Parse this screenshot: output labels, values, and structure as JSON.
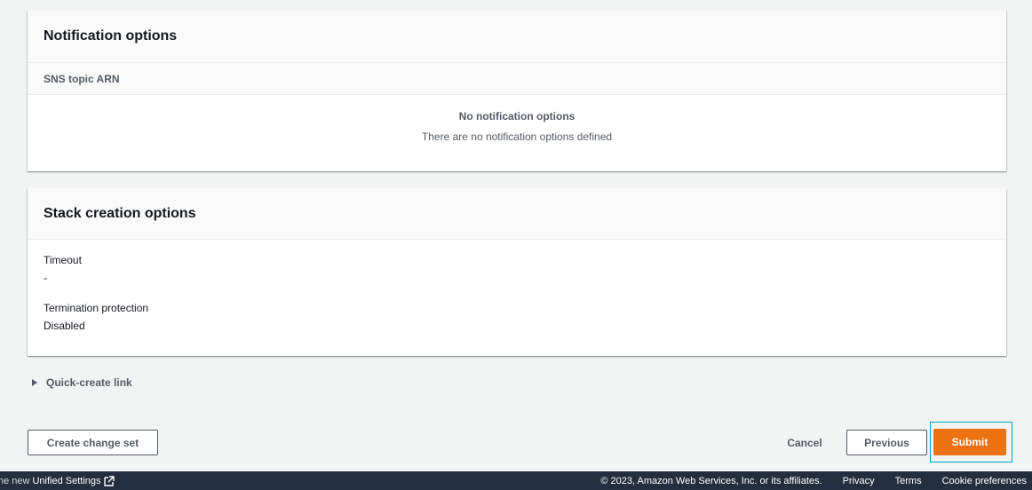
{
  "notification": {
    "title": "Notification options",
    "column": "SNS topic ARN",
    "empty_title": "No notification options",
    "empty_desc": "There are no notification options defined"
  },
  "stack": {
    "title": "Stack creation options",
    "items": [
      {
        "key": "Timeout",
        "value": "-"
      },
      {
        "key": "Termination protection",
        "value": "Disabled"
      }
    ]
  },
  "quick_create": {
    "label": "Quick-create link"
  },
  "actions": {
    "create_change_set": "Create change set",
    "cancel": "Cancel",
    "previous": "Previous",
    "submit": "Submit"
  },
  "footer": {
    "left_prefix": "he new",
    "left_link": "Unified Settings",
    "copyright": "© 2023, Amazon Web Services, Inc. or its affiliates.",
    "privacy": "Privacy",
    "terms": "Terms",
    "cookies": "Cookie preferences"
  },
  "colors": {
    "accent": "#ec7211",
    "footer_bg": "#232f3e",
    "page_bg": "#f2f3f3"
  }
}
